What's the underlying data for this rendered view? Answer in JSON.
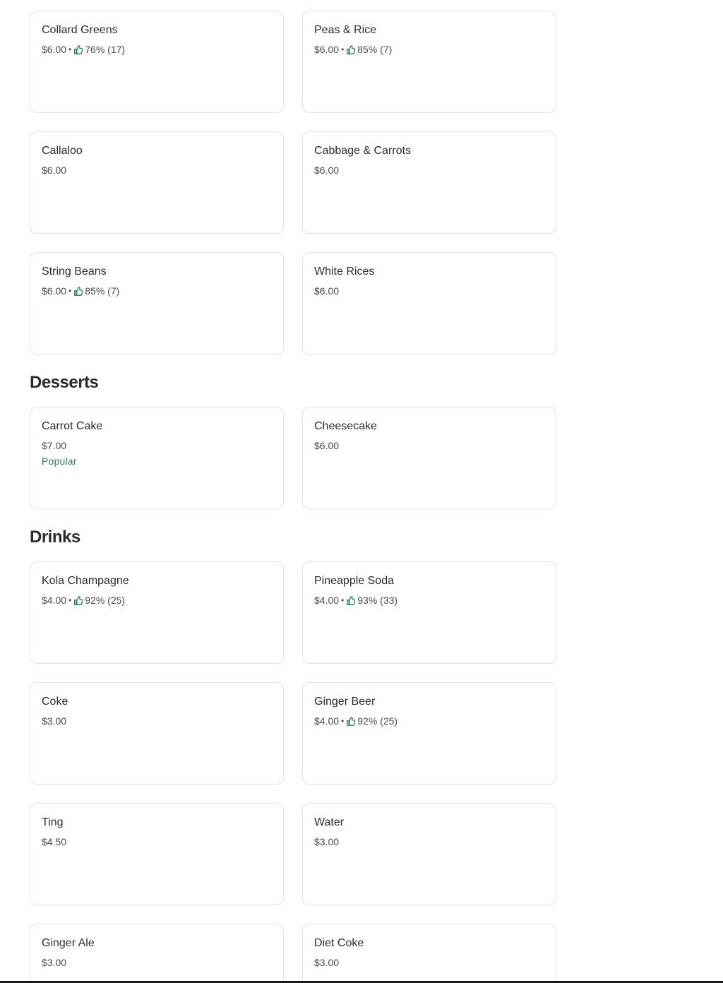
{
  "colors": {
    "rating_green": "#2e7d54",
    "popular_green": "#2e7d54",
    "border": "#e3e3e3"
  },
  "sections": {
    "sides": {
      "items": [
        {
          "name": "Collard Greens",
          "price": "$6.00",
          "separator": "•",
          "rating": "76% (17)",
          "icon": "thumbs-up-icon"
        },
        {
          "name": "Peas & Rice",
          "price": "$6.00",
          "separator": "•",
          "rating": "85% (7)",
          "icon": "thumbs-up-icon"
        },
        {
          "name": "Callaloo",
          "price": "$6.00"
        },
        {
          "name": "Cabbage & Carrots",
          "price": "$6.00"
        },
        {
          "name": "String Beans",
          "price": "$6.00",
          "separator": "•",
          "rating": "85% (7)",
          "icon": "thumbs-up-icon"
        },
        {
          "name": "White Rices",
          "price": "$6.00"
        }
      ]
    },
    "desserts": {
      "title": "Desserts",
      "items": [
        {
          "name": "Carrot Cake",
          "price": "$7.00",
          "badge": "Popular"
        },
        {
          "name": "Cheesecake",
          "price": "$6.00"
        }
      ]
    },
    "drinks": {
      "title": "Drinks",
      "items": [
        {
          "name": "Kola Champagne",
          "price": "$4.00",
          "separator": "•",
          "rating": "92% (25)",
          "icon": "thumbs-up-icon"
        },
        {
          "name": "Pineapple Soda",
          "price": "$4.00",
          "separator": "•",
          "rating": "93% (33)",
          "icon": "thumbs-up-icon"
        },
        {
          "name": "Coke",
          "price": "$3.00"
        },
        {
          "name": "Ginger Beer",
          "price": "$4.00",
          "separator": "•",
          "rating": "92% (25)",
          "icon": "thumbs-up-icon"
        },
        {
          "name": "Ting",
          "price": "$4.50"
        },
        {
          "name": "Water",
          "price": "$3.00"
        },
        {
          "name": "Ginger Ale",
          "price": "$3.00"
        },
        {
          "name": "Diet Coke",
          "price": "$3.00"
        }
      ]
    }
  }
}
